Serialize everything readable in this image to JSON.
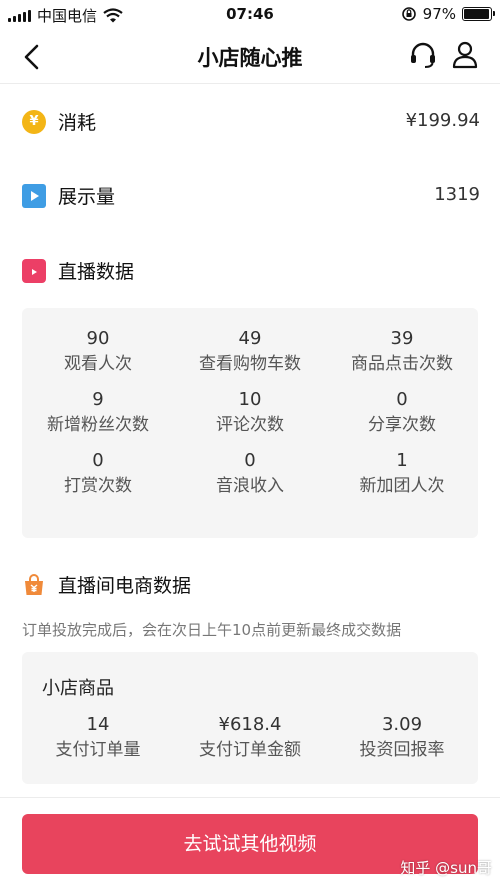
{
  "status_bar": {
    "carrier": "中国电信",
    "time": "07:46",
    "battery_percent": "97%",
    "battery_level": 0.97
  },
  "nav": {
    "title": "小店随心推",
    "icons": [
      "back-arrow-icon",
      "headset-service-icon",
      "user-icon"
    ]
  },
  "consumption": {
    "label": "消耗",
    "value": "¥199.94",
    "icon_text": "¥",
    "icon": "yen-coin-icon",
    "color": "#f3b516"
  },
  "impressions": {
    "label": "展示量",
    "value": "1319",
    "icon": "play-icon",
    "color": "#3f9de4"
  },
  "live_data": {
    "title": "直播数据",
    "icon": "tv-icon",
    "color": "#ec3f66",
    "stats": [
      {
        "value": "90",
        "label": "观看人次"
      },
      {
        "value": "49",
        "label": "查看购物车数"
      },
      {
        "value": "39",
        "label": "商品点击次数"
      },
      {
        "value": "9",
        "label": "新增粉丝次数"
      },
      {
        "value": "10",
        "label": "评论次数"
      },
      {
        "value": "0",
        "label": "分享次数"
      },
      {
        "value": "0",
        "label": "打赏次数"
      },
      {
        "value": "0",
        "label": "音浪收入"
      },
      {
        "value": "1",
        "label": "新加团人次"
      }
    ]
  },
  "ecommerce": {
    "title": "直播间电商数据",
    "icon": "shopping-bag-icon",
    "color": "#f08a3a",
    "note": "订单投放完成后，会在次日上午10点前更新最终成交数据",
    "shop_title": "小店商品",
    "stats": [
      {
        "value": "14",
        "label": "支付订单量"
      },
      {
        "value": "¥618.4",
        "label": "支付订单金额"
      },
      {
        "value": "3.09",
        "label": "投资回报率"
      }
    ]
  },
  "cta": {
    "label": "去试试其他视频",
    "color": "#e8445d"
  },
  "watermark": "知乎 @sun哥"
}
